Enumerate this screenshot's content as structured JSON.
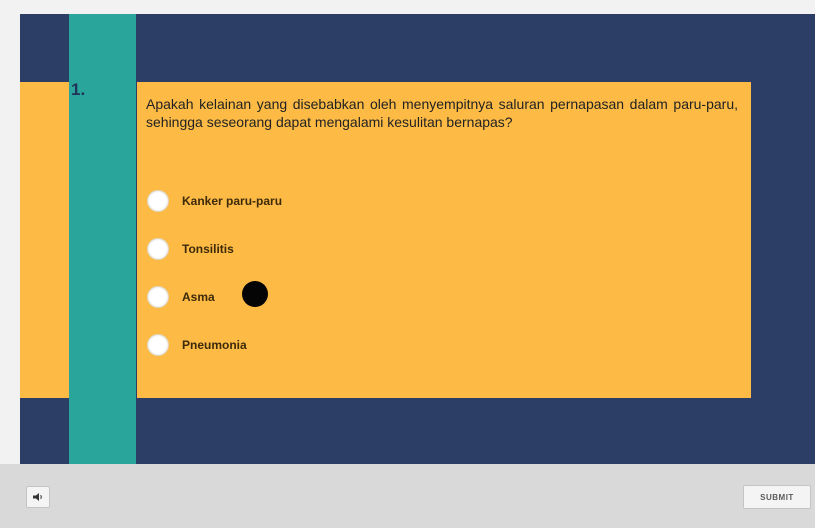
{
  "quiz": {
    "number": "1.",
    "question": "Apakah kelainan yang disebabkan oleh menyempitnya saluran pernapasan dalam paru-paru, sehingga seseorang dapat mengalami kesulitan bernapas?",
    "options": [
      {
        "label": "Kanker paru-paru",
        "selected": false
      },
      {
        "label": "Tonsilitis",
        "selected": false
      },
      {
        "label": "Asma",
        "selected": false
      },
      {
        "label": "Pneumonia",
        "selected": false
      }
    ]
  },
  "controls": {
    "submit_label": "SUBMIT",
    "audio_icon": "speaker-icon"
  },
  "colors": {
    "background_navy": "#2c3e66",
    "accent_teal": "#2aa59b",
    "card_yellow": "#fdbb45",
    "bottom_bar": "#d9d9d9"
  }
}
